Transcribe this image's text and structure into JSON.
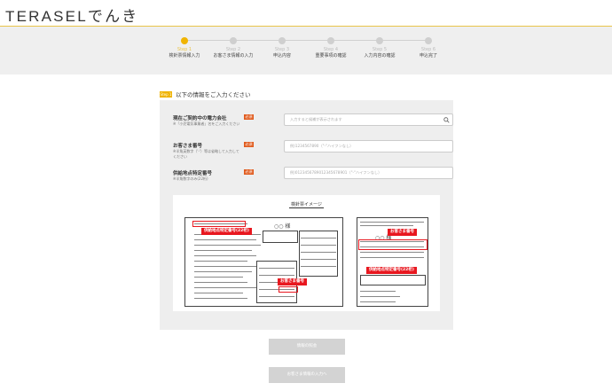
{
  "header": {
    "logo": "TERASELでんき"
  },
  "steps": [
    {
      "num": "Step 1",
      "label": "検針票情報入力",
      "active": true
    },
    {
      "num": "Step 2",
      "label": "お客さま情報の入力",
      "active": false
    },
    {
      "num": "Step 3",
      "label": "申込内容",
      "active": false
    },
    {
      "num": "Step 4",
      "label": "重要事項の確認",
      "active": false
    },
    {
      "num": "Step 5",
      "label": "入力内容の確認",
      "active": false
    },
    {
      "num": "Step 6",
      "label": "申込完了",
      "active": false
    }
  ],
  "section": {
    "badge": "Step 1",
    "title": "以下の情報をご入力ください"
  },
  "form": {
    "required_label": "必須",
    "company": {
      "label": "現在ご契約中の電力会社",
      "note": "※「小売電気事業者」名をご入力ください",
      "placeholder": "入力すると候補が表示されます"
    },
    "customer_no": {
      "label": "お客さま番号",
      "note_line1": "※半角英数字（'-'）等は省略して入力して",
      "note_line2": "ください",
      "placeholder": "例)1234567890（\"-\"ハイフンなし）"
    },
    "supply_no": {
      "label": "供給地点特定番号",
      "note": "※半角数字のみ(22桁)",
      "placeholder": "例)0123456789012345678901（\"-\"ハイフンなし）"
    }
  },
  "bill_image": {
    "title": "検針票イメージ",
    "tag_supply": "供給地点特定番号(22桁)",
    "tag_customer": "お客さま番号",
    "tag_customer_right": "お客さま番号",
    "tag_supply_right": "供給地点特定番号(22桁)"
  },
  "buttons": {
    "confirm": "情報の照会",
    "next": "お客さま情報の入力へ"
  },
  "colors": {
    "accent": "#f0b400",
    "required": "#e05a1c",
    "highlight": "#e8171f"
  }
}
